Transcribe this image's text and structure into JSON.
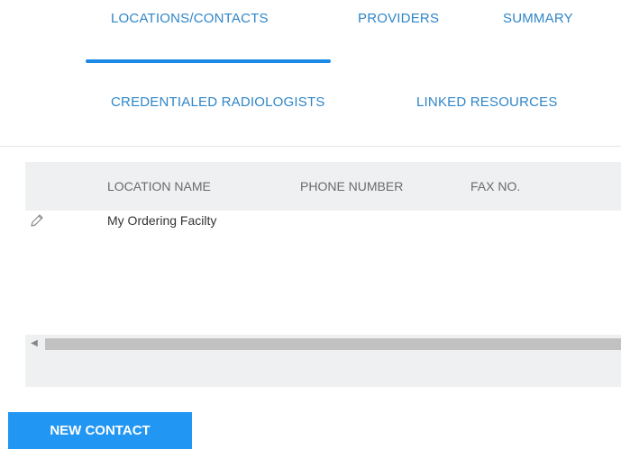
{
  "tabs": {
    "row1": [
      "LOCATIONS/CONTACTS",
      "PROVIDERS",
      "SUMMARY"
    ],
    "row2": [
      "CREDENTIALED RADIOLOGISTS",
      "LINKED RESOURCES"
    ],
    "active": "LOCATIONS/CONTACTS"
  },
  "table": {
    "columns": [
      "LOCATION NAME",
      "PHONE NUMBER",
      "FAX NO."
    ],
    "rows": [
      {
        "location_name": "My Ordering Facilty",
        "phone_number": "",
        "fax_no": ""
      }
    ]
  },
  "icons": {
    "edit": "pencil-icon",
    "scroll_left": "scroll-left-arrow-icon"
  },
  "actions": {
    "new_contact": "NEW CONTACT"
  },
  "colors": {
    "accent": "#1e88e5",
    "tab_text": "#2f86c8",
    "button": "#2196f3",
    "header_bg": "#eef0f2"
  }
}
